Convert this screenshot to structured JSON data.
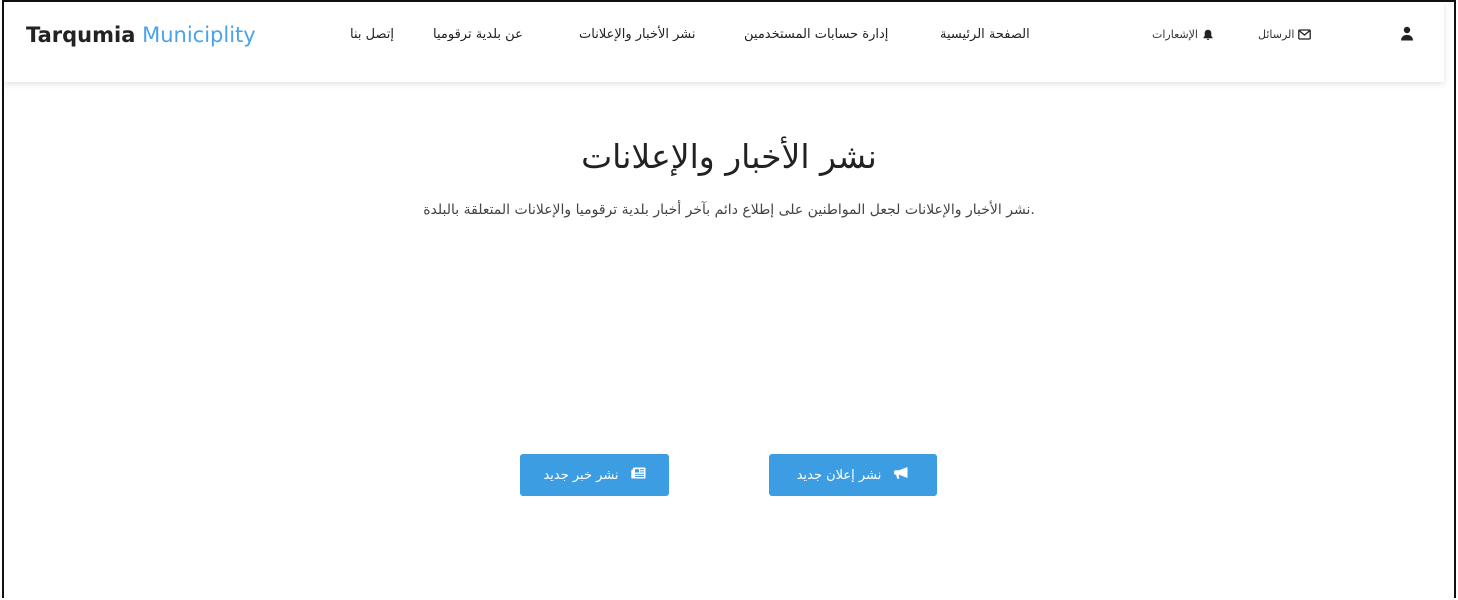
{
  "brand": {
    "name_part1": "Tarqumia",
    "name_part2": "Municiplity"
  },
  "nav": {
    "contact": "إتصل بنا",
    "about": "عن بلدية ترقوميا",
    "publish_news": "نشر الأخبار والإعلانات",
    "manage_accounts": "إدارة حسابات المستخدمين",
    "home": "الصفحة الرئيسية"
  },
  "utility": {
    "notifications": "الإشعارات",
    "messages": "الرسائل",
    "icons": [
      "bell-icon",
      "envelope-icon",
      "user-icon"
    ]
  },
  "main": {
    "title": "نشر الأخبار والإعلانات",
    "subtitle": ".نشر الأخبار والإعلانات لجعل المواطنين على إطلاع دائم بآخر أخبار بلدية ترقوميا والإعلانات المتعلقة بالبلدة"
  },
  "actions": {
    "new_announcement": "نشر إعلان جديد",
    "new_news": "نشر خبر جديد"
  },
  "colors": {
    "accent": "#3d9de3",
    "brand_highlight": "#4aa3e8"
  }
}
